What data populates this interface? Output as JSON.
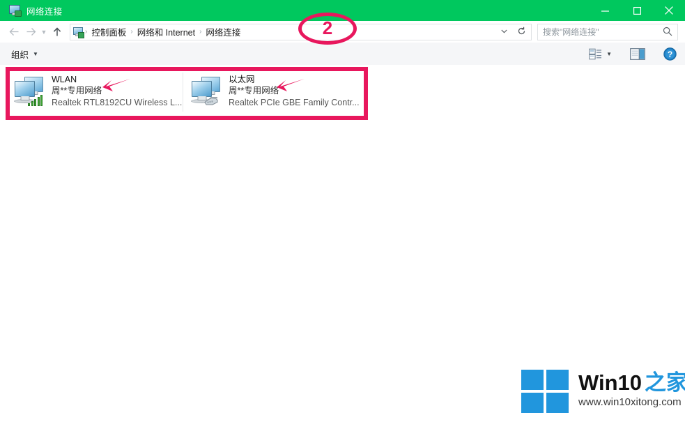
{
  "window": {
    "title": "网络连接",
    "title_icon": "network-connection-icon",
    "accent_color": "#00c85e",
    "minimize_label": "最小化",
    "maximize_label": "最大化",
    "close_label": "关闭"
  },
  "address_bar": {
    "back_label": "后退",
    "forward_label": "前进",
    "recent_label": "最近浏览的位置",
    "up_label": "上移一级",
    "crumb_icon": "network-connection-icon",
    "breadcrumbs": [
      "控制面板",
      "网络和 Internet",
      "网络连接"
    ],
    "separator": "›",
    "dropdown_label": "▼",
    "refresh_label": "↻"
  },
  "search": {
    "placeholder": "搜索\"网络连接\"",
    "icon": "search-icon"
  },
  "toolbar": {
    "organize_label": "组织",
    "organize_caret": "▼",
    "view_icon": "change-view-icon",
    "view_caret": "▼",
    "preview_icon": "preview-pane-icon",
    "help_icon": "help-icon",
    "help_glyph": "?"
  },
  "connections": [
    {
      "name": "WLAN",
      "status": "周**专用网络",
      "device": "Realtek RTL8192CU Wireless L...",
      "icon": "wireless-network-icon"
    },
    {
      "name": "以太网",
      "status": "周**专用网络",
      "device": "Realtek PCIe GBE Family Contr...",
      "icon": "ethernet-network-icon"
    }
  ],
  "annotations": {
    "step_number": "2",
    "highlight_color": "#e8175d",
    "arrow_count": 2
  },
  "watermark": {
    "brand_black": "Win10",
    "brand_blue": "之家",
    "url": "www.win10xitong.com",
    "logo_color": "#2196dd"
  }
}
